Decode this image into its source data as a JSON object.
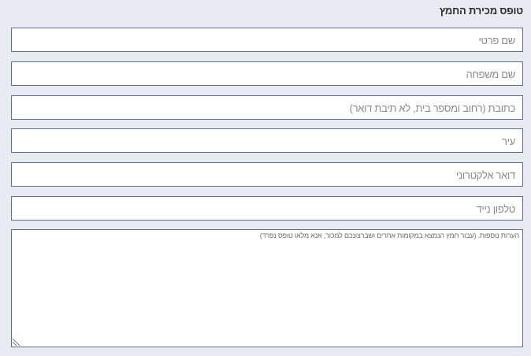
{
  "form": {
    "title": "טופס מכירת החמץ",
    "fields": [
      {
        "label": "שם פרטי"
      },
      {
        "label": "שם משפחה"
      },
      {
        "label": "כתובת (רחוב ומספר בית, לא תיבת דואר)"
      },
      {
        "label": "עיר"
      },
      {
        "label": "דואר אלקטרוני"
      },
      {
        "label": "טלפון נייד"
      }
    ],
    "notes": {
      "label": "הערות נוספות. (עבור חמץ הנמצא במקומות אחרים ושברצונכם למכור, אנא מלאו טופס נפרד)"
    }
  },
  "colors": {
    "background": "#e9ebf2",
    "field_border": "#5a6f9c",
    "placeholder": "#8b8b8b"
  }
}
